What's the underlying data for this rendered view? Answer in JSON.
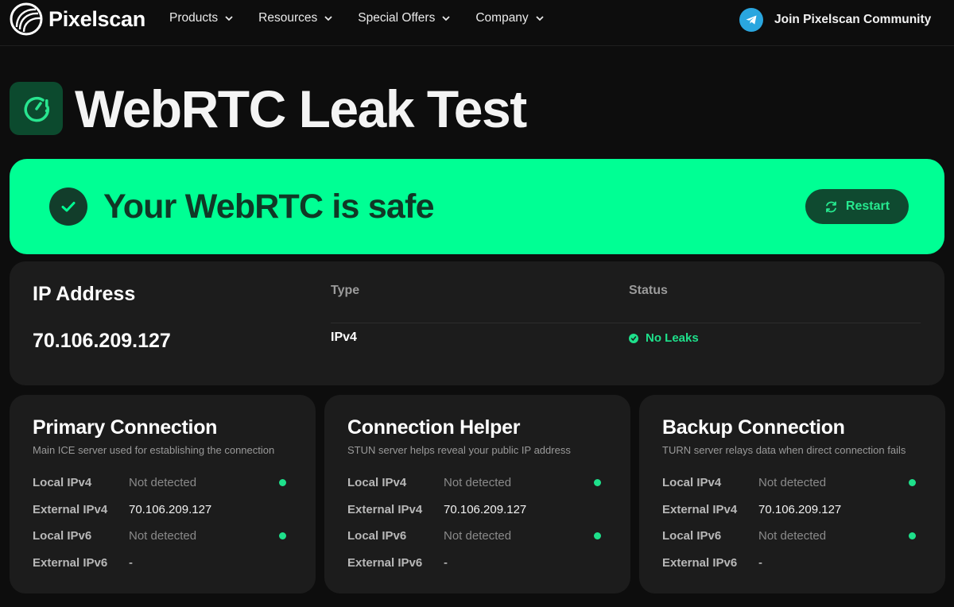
{
  "nav": {
    "brand": "Pixelscan",
    "menu": [
      {
        "label": "Products"
      },
      {
        "label": "Resources"
      },
      {
        "label": "Special Offers"
      },
      {
        "label": "Company"
      }
    ],
    "community_label": "Join Pixelscan Community",
    "icons": {
      "logo": "pixelscan-logo",
      "community": "telegram-icon",
      "menu_caret": "chevron-down-icon"
    }
  },
  "hero": {
    "title": "WebRTC Leak Test",
    "icon": "webrtc-gauge-icon"
  },
  "banner": {
    "message": "Your WebRTC is safe",
    "restart_label": "Restart",
    "icons": {
      "status": "check-icon",
      "restart": "refresh-icon"
    }
  },
  "ip_card": {
    "ip_heading": "IP Address",
    "type_heading": "Type",
    "status_heading": "Status",
    "ip": "70.106.209.127",
    "type": "IPv4",
    "status": "No Leaks"
  },
  "connections": [
    {
      "title": "Primary Connection",
      "subtitle": "Main ICE server used for establishing the connection",
      "rows": [
        {
          "label": "Local IPv4",
          "value": "Not detected"
        },
        {
          "label": "External IPv4",
          "value": "70.106.209.127"
        },
        {
          "label": "Local IPv6",
          "value": "Not detected"
        },
        {
          "label": "External IPv6",
          "value": "-"
        }
      ]
    },
    {
      "title": "Connection Helper",
      "subtitle": "STUN server helps reveal your public IP address",
      "rows": [
        {
          "label": "Local IPv4",
          "value": "Not detected"
        },
        {
          "label": "External IPv4",
          "value": "70.106.209.127"
        },
        {
          "label": "Local IPv6",
          "value": "Not detected"
        },
        {
          "label": "External IPv6",
          "value": "-"
        }
      ]
    },
    {
      "title": "Backup Connection",
      "subtitle": "TURN server relays data when direct connection fails",
      "rows": [
        {
          "label": "Local IPv4",
          "value": "Not detected"
        },
        {
          "label": "External IPv4",
          "value": "70.106.209.127"
        },
        {
          "label": "Local IPv6",
          "value": "Not detected"
        },
        {
          "label": "External IPv6",
          "value": "-"
        }
      ]
    }
  ],
  "colors": {
    "background": "#0d0d0d",
    "card": "#1c1c1c",
    "accent_green": "#00ff94",
    "status_green": "#1ee08b",
    "banner_text": "#103826"
  }
}
